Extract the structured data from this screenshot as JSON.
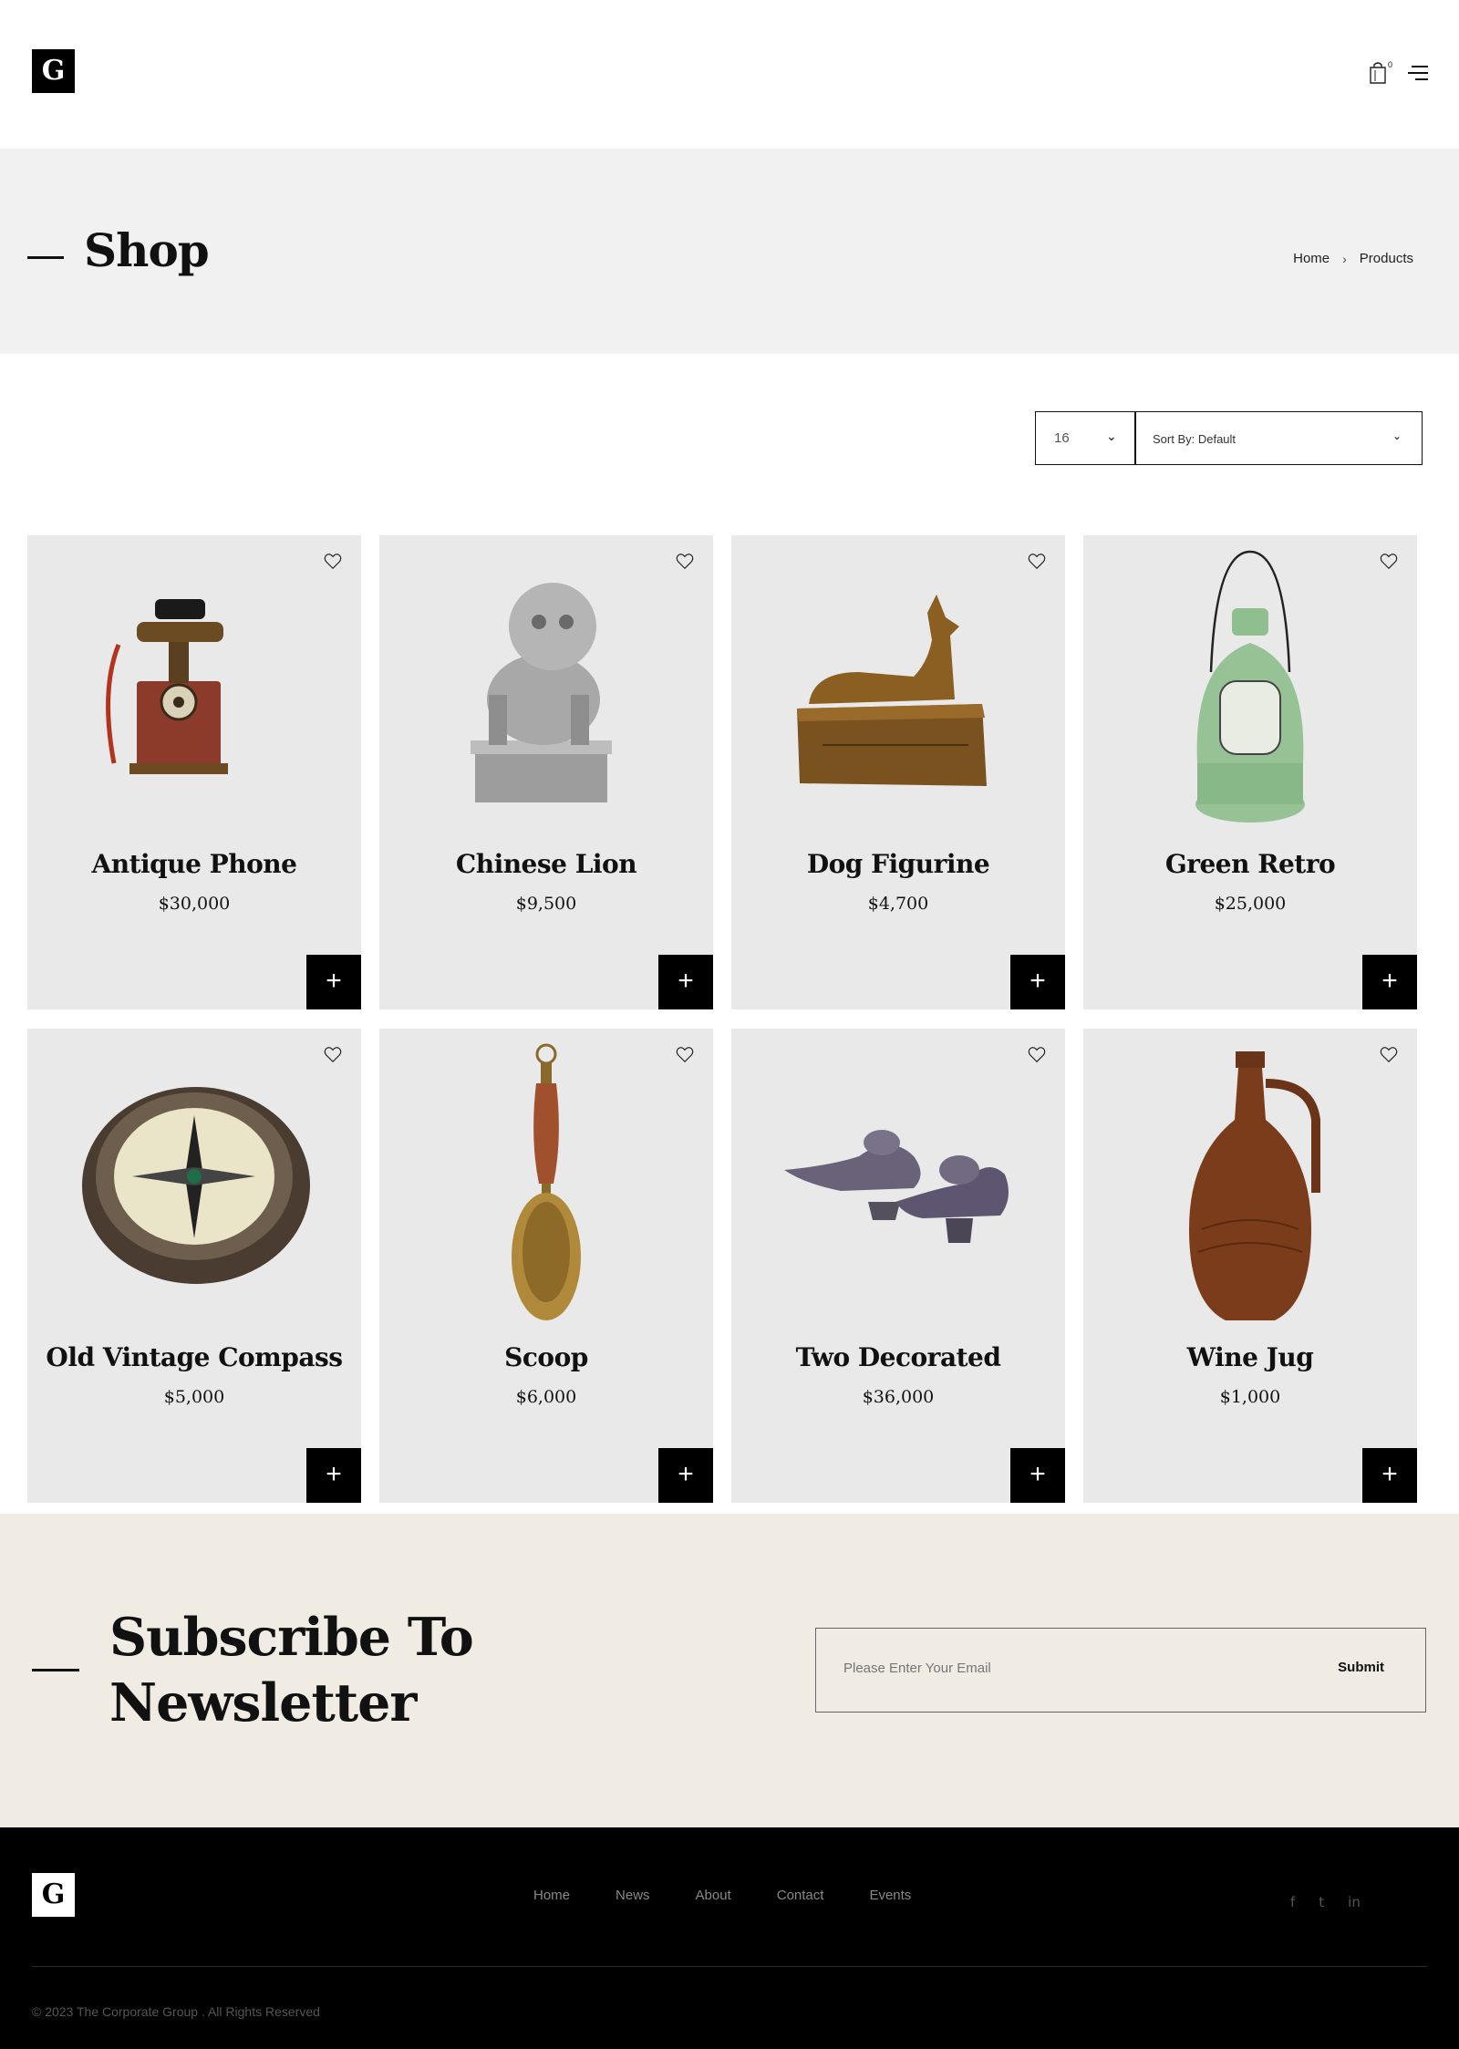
{
  "header": {
    "logo_letter": "G",
    "cart_count": "0"
  },
  "banner": {
    "title": "Shop",
    "breadcrumb": {
      "home": "Home",
      "current": "Products"
    }
  },
  "toolbar": {
    "per_page": "16",
    "sort": "Sort By: Default"
  },
  "products": [
    {
      "name": "Antique Phone",
      "price": "$30,000"
    },
    {
      "name": "Chinese Lion",
      "price": "$9,500"
    },
    {
      "name": "Dog Figurine",
      "price": "$4,700"
    },
    {
      "name": "Green Retro",
      "price": "$25,000"
    },
    {
      "name": "Old Vintage Compass",
      "price": "$5,000"
    },
    {
      "name": "Scoop",
      "price": "$6,000"
    },
    {
      "name": "Two Decorated",
      "price": "$36,000"
    },
    {
      "name": "Wine Jug",
      "price": "$1,000"
    }
  ],
  "add_label": "+",
  "newsletter": {
    "title_line1": "Subscribe To",
    "title_line2": "Newsletter",
    "placeholder": "Please Enter Your Email",
    "submit": "Submit"
  },
  "footer": {
    "logo_letter": "G",
    "nav": [
      "Home",
      "News",
      "About",
      "Contact",
      "Events"
    ],
    "social": [
      "f",
      "t",
      "in"
    ],
    "copyright": "© 2023 The Corporate Group . All Rights Reserved"
  },
  "colors": {
    "card_bg": "#e9e9e9",
    "banner_bg": "#f1f1f1",
    "newsletter_bg": "#f0ece4",
    "footer_bg": "#000000"
  }
}
